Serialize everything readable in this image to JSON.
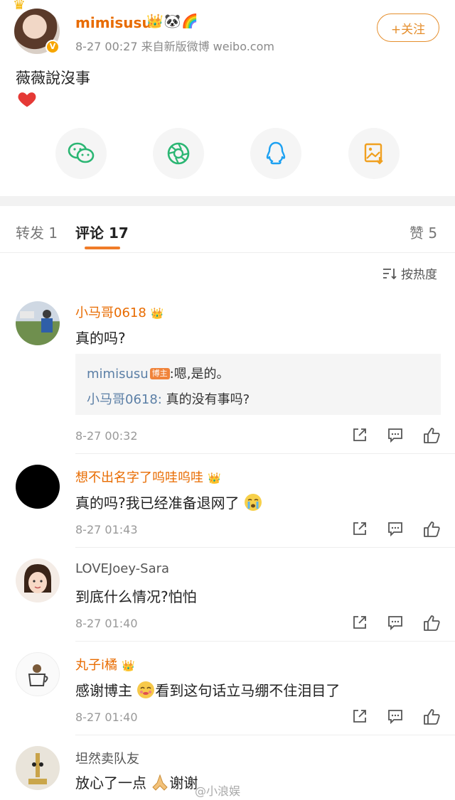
{
  "post": {
    "username": "mimisusu",
    "badges": "👑🐼🌈",
    "meta": "8-27 00:27  来自新版微博 weibo.com",
    "follow_label": "+关注",
    "text": "薇薇說沒事"
  },
  "tabs": {
    "repost": "转发 1",
    "comments": "评论 17",
    "likes": "赞 5"
  },
  "sort_label": "按热度",
  "comments": [
    {
      "name": "小马哥0618",
      "text": "真的吗?",
      "time": "8-27 00:32",
      "replies": {
        "line1_name": "mimisusu",
        "line1_tag": "博主",
        "line1_text": ":嗯,是的。",
        "line2_name": "小马哥0618:",
        "line2_text": " 真的没有事吗?"
      }
    },
    {
      "name": "想不出名字了呜哇呜哇",
      "text": "真的吗?我已经准备退网了",
      "time": "8-27 01:43"
    },
    {
      "name": "LOVEJoey-Sara",
      "text": "到底什么情况?怕怕",
      "time": "8-27 01:40"
    },
    {
      "name": "丸子i橘",
      "text_before": "感谢博主",
      "text_after": "看到这句话立马绷不住泪目了",
      "time": "8-27 01:40"
    },
    {
      "name": "坦然卖队友",
      "text_before": "放心了一点",
      "text_after": "谢谢"
    }
  ],
  "watermark": "@小浪娱",
  "colors": {
    "accent": "#e86b00",
    "tab_underline": "#f07c28",
    "follow": "#e58e2c",
    "reply_blue": "#5b7fa6"
  }
}
